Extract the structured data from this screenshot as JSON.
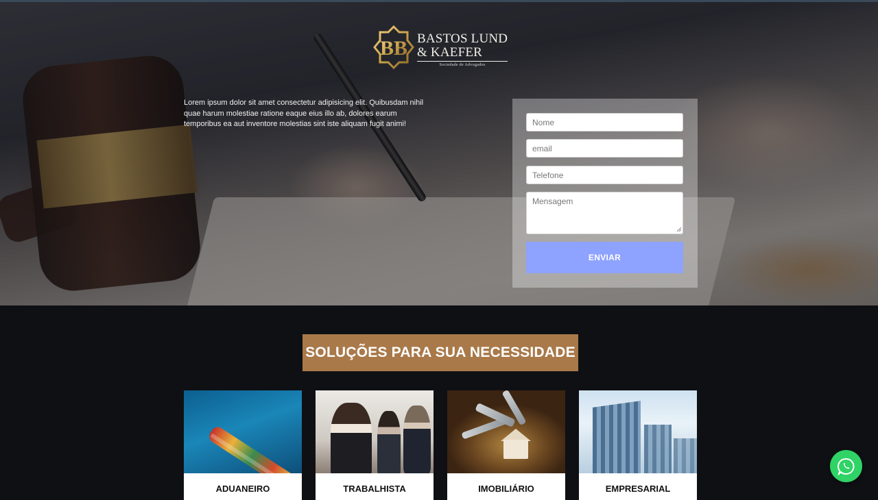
{
  "brand": {
    "name_line1": "BASTOS LUND",
    "name_line2": "& KAEFER",
    "tagline": "Sociedade de Advogados",
    "monogram": "BB",
    "gold": "#c9a24a"
  },
  "hero": {
    "intro": "Lorem ipsum dolor sit amet consectetur adipisicing elit. Quibusdam nihil quae harum molestiae ratione eaque eius illo ab, dolores earum temporibus ea aut inventore molestias sint iste aliquam fugit animi!"
  },
  "contact_form": {
    "name_placeholder": "Nome",
    "email_placeholder": "email",
    "phone_placeholder": "Telefone",
    "message_placeholder": "Mensagem",
    "submit_label": "ENVIAR",
    "submit_color": "#8ea2ff"
  },
  "solutions": {
    "title": "SOLUÇÕES PARA SUA NECESSIDADE",
    "title_bg": "#a9794a",
    "cards": [
      {
        "label": "ADUANEIRO",
        "image": "cargo-ship-image"
      },
      {
        "label": "TRABALHISTA",
        "image": "business-team-image"
      },
      {
        "label": "IMOBILIÁRIO",
        "image": "house-keys-image"
      },
      {
        "label": "EMPRESARIAL",
        "image": "office-building-image"
      }
    ]
  },
  "whatsapp": {
    "icon": "whatsapp-icon",
    "color": "#2fd366"
  }
}
